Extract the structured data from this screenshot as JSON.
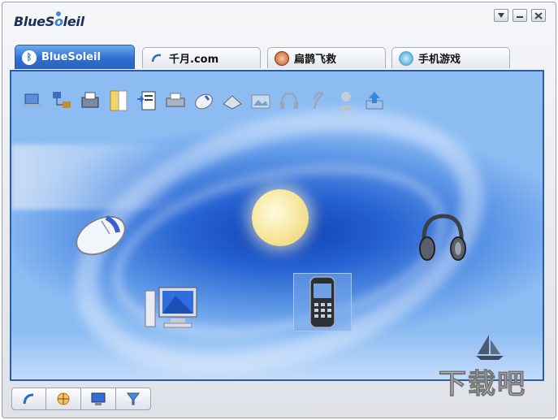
{
  "app": {
    "logo_left": "BlueS",
    "logo_o": "o",
    "logo_right": "leil"
  },
  "tabs": [
    {
      "label": "BlueSoleil",
      "icon": "bluetooth-icon",
      "active": true
    },
    {
      "label": "千月.com",
      "icon": "arc-icon",
      "active": false
    },
    {
      "label": "扁鹊飞救",
      "icon": "medical-icon",
      "active": false
    },
    {
      "label": "手机游戏",
      "icon": "globe-icon",
      "active": false
    }
  ],
  "toolbar_icons": [
    "network-access-icon",
    "lan-access-icon",
    "fax-icon",
    "file-transfer-icon",
    "sync-icon",
    "printer-icon",
    "hid-mouse-icon",
    "scanner-icon",
    "image-transfer-icon",
    "headset-icon",
    "earpiece-icon",
    "user-icon",
    "upload-icon"
  ],
  "devices": [
    "mouse-device-icon",
    "computer-device-icon",
    "phone-device-icon",
    "headphones-device-icon"
  ],
  "watermark": "下载吧",
  "bottom_buttons": [
    "service-icon",
    "connect-icon",
    "display-icon",
    "filter-icon"
  ],
  "colors": {
    "accent": "#2f6fd0",
    "panel_dark": "#0e3fb3"
  }
}
